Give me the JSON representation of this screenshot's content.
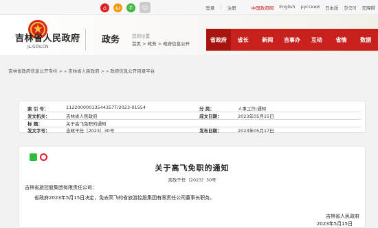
{
  "topbar": {
    "links": [
      "登录",
      "注册",
      "中国政府网",
      "English",
      "русский",
      "日本語",
      "한국어",
      "无障碍"
    ],
    "icons": [
      "wechat-icon",
      "weibo-icon",
      "app-icon",
      "mascot-icon"
    ]
  },
  "header": {
    "site_title": "吉林省人民政府",
    "site_url": "JL.GOV.CN",
    "section_title": "政务",
    "location_label": "您的位置",
    "breadcrumb": "首页  >  政务  >  政府信息公开"
  },
  "mainnav": [
    "省政府",
    "省长",
    "新闻",
    "吉事办",
    "互动",
    "省情",
    "数据"
  ],
  "crumb": "吉林省政府信息公开专栏 > » 吉林省人民政府 > » 政府信息公开目录平台",
  "meta": {
    "index_label": "索    引    号：",
    "index_value": "11220000013544357T/2023-01554",
    "category_label": "分    类：",
    "category_value": "人事工作;通知",
    "issuer_label": "发文机关：",
    "issuer_value": "吉林省人民政府",
    "written_label": "成文日期：",
    "written_value": "2023年05月15日",
    "title_label": "标    题：",
    "title_value": "关于高飞免职的通知",
    "docno_label": "发文字号：",
    "docno_value": "吉政干任〔2023〕30号",
    "published_label": "发布日期：",
    "published_value": "2023年05月17日"
  },
  "doc": {
    "title": "关于高飞免职的通知",
    "number": "吉政干任〔2023〕30号",
    "to": "吉林省旅控股集团有限责任公司：",
    "body": "省政府2023年5月15日决定，免去高飞的省旅游控股集团有限责任公司董事长职务。",
    "sign": "吉林省人民政府",
    "date": "2023年5月15日"
  },
  "colors": {
    "brand_red": "#c8201c",
    "wechat": "#2dbd3a",
    "weibo": "#e6162d"
  }
}
